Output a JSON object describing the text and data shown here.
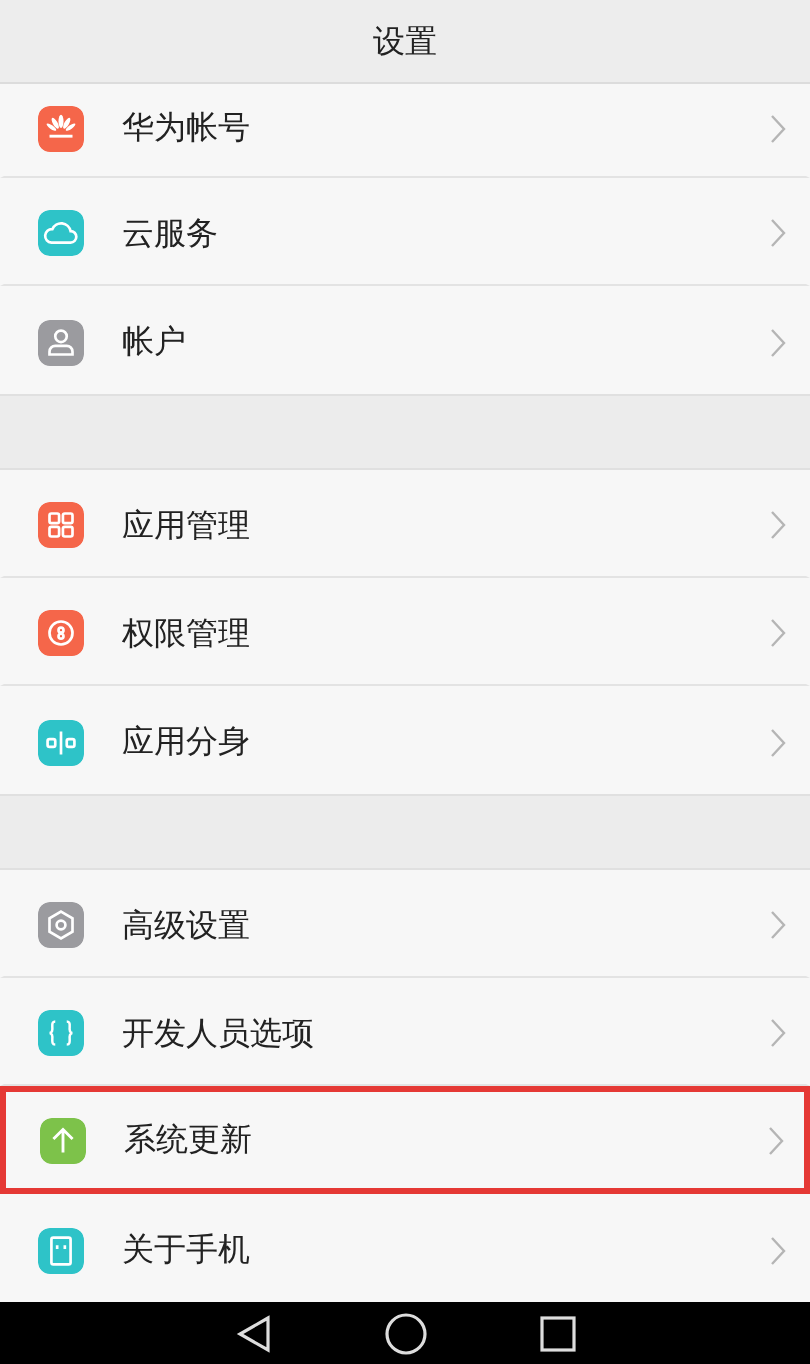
{
  "header": {
    "title": "设置"
  },
  "groups": [
    {
      "items": [
        {
          "label": "华为帐号",
          "kind": "flower",
          "color": "#f5664a",
          "highlighted": false
        },
        {
          "label": "云服务",
          "kind": "cloud",
          "color": "#2ec3c8",
          "highlighted": false
        },
        {
          "label": "帐户",
          "kind": "user",
          "color": "#9b9b9f",
          "highlighted": false
        }
      ]
    },
    {
      "items": [
        {
          "label": "应用管理",
          "kind": "grid",
          "color": "#f5664a",
          "highlighted": false
        },
        {
          "label": "权限管理",
          "kind": "shield",
          "color": "#f5664a",
          "highlighted": false
        },
        {
          "label": "应用分身",
          "kind": "clone",
          "color": "#2ec3c8",
          "highlighted": false
        }
      ]
    },
    {
      "items": [
        {
          "label": "高级设置",
          "kind": "gear",
          "color": "#9b9b9f",
          "highlighted": false
        },
        {
          "label": "开发人员选项",
          "kind": "braces",
          "color": "#2ec3c8",
          "highlighted": false
        },
        {
          "label": "系统更新",
          "kind": "arrow",
          "color": "#7dc24a",
          "highlighted": true
        },
        {
          "label": "关于手机",
          "kind": "phone",
          "color": "#2ec3c8",
          "highlighted": false
        }
      ]
    }
  ]
}
